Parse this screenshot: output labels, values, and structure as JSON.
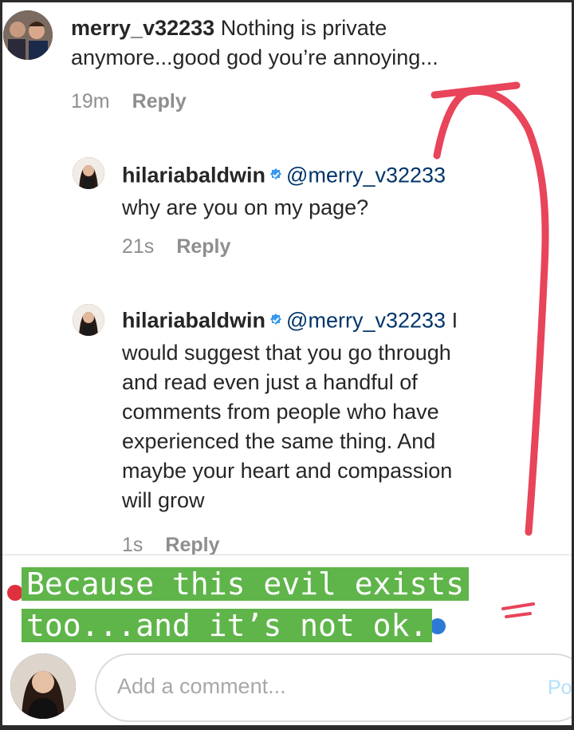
{
  "comments": [
    {
      "username": "merry_v32233",
      "text_line1": "Nothing is private",
      "text_line2": "anymore...good god you’re annoying...",
      "time": "19m",
      "reply": "Reply"
    },
    {
      "username": "hilariabaldwin",
      "mention": "@merry_v32233",
      "text_line1": "why are you on my page?",
      "time": "21s",
      "reply": "Reply"
    },
    {
      "username": "hilariabaldwin",
      "mention": "@merry_v32233",
      "text_first": "I",
      "text_lines": [
        "would suggest that you go through",
        "and read even just a handful of",
        "comments from people who have",
        "experienced the same thing. And",
        "maybe your heart and compassion",
        "will grow"
      ],
      "time": "1s",
      "reply": "Reply"
    }
  ],
  "sticker": {
    "line1": "Because this evil exists",
    "line2": "too...and it’s not ok.",
    "background": "#5fb54a",
    "color": "#ffffff"
  },
  "composer": {
    "placeholder": "Add a comment...",
    "post_label": "Po"
  },
  "colors": {
    "arrow": "#e8445a",
    "verified": "#3897f0",
    "mention": "#003569",
    "meta": "#8e8e8e"
  }
}
